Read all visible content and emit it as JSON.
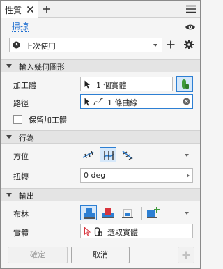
{
  "tab": {
    "title": "性質"
  },
  "preset": {
    "label": "掃掠",
    "selected": "上次使用"
  },
  "sections": {
    "input_geometry": {
      "title": "輸入幾何圖形",
      "profile_label": "加工體",
      "profile_value": "1 個實體",
      "path_label": "路徑",
      "path_value": "1 條曲線",
      "keep_tool_label": "保留加工體"
    },
    "behavior": {
      "title": "行為",
      "orientation_label": "方位",
      "twist_label": "扭轉",
      "twist_value": "0 deg"
    },
    "output": {
      "title": "輸出",
      "boolean_label": "布林",
      "solid_label": "實體",
      "solid_value": "選取實體"
    }
  },
  "buttons": {
    "ok": "確定",
    "cancel": "取消"
  },
  "colors": {
    "accent": "#2d7fd3",
    "link": "#1f6fd1",
    "header_bg": "#e4e4e4"
  },
  "icons": [
    "close-icon",
    "add-tab-icon",
    "menu-icon",
    "eye-icon",
    "clock-icon",
    "plus-icon",
    "gear-icon",
    "cursor-icon",
    "curve-icon",
    "clear-icon",
    "body-icon",
    "path-orient-icon",
    "fixed-orient-icon",
    "parallel-orient-icon",
    "join-icon",
    "cut-icon",
    "intersect-icon",
    "new-body-icon"
  ]
}
